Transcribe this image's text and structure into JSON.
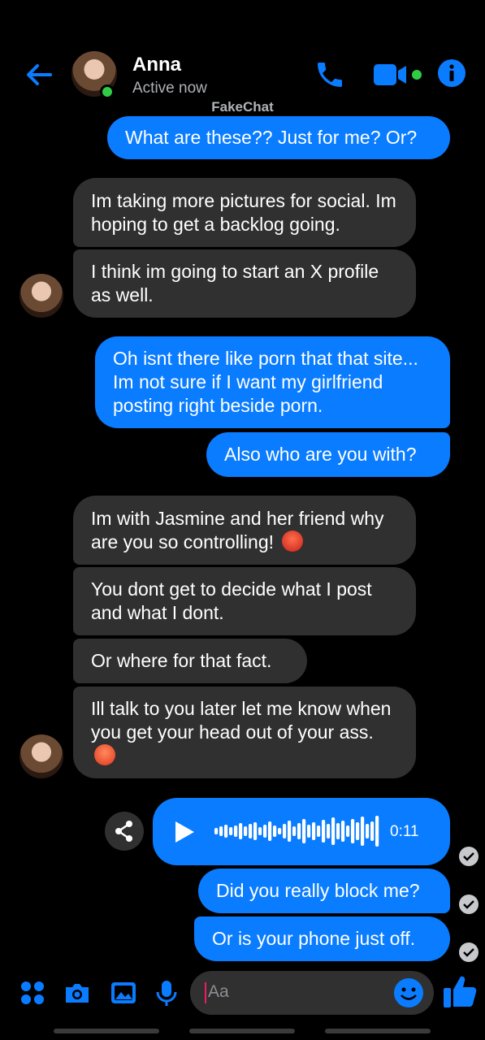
{
  "header": {
    "name": "Anna",
    "status": "Active now",
    "watermark": "FakeChat"
  },
  "messages": [
    {
      "text": "What are these?? Just for me? Or?"
    },
    {
      "text": "Im taking more pictures for social. Im hoping to get a backlog going."
    },
    {
      "text": "I think im going to start an X profile as well."
    },
    {
      "text": "Oh isnt there like porn that that site... Im not sure if I want my girlfriend posting right beside porn."
    },
    {
      "text": "Also who are you with?"
    },
    {
      "text": "Im with Jasmine and her friend why are you so controlling!"
    },
    {
      "text": "You dont get to decide what I post and what I dont."
    },
    {
      "text": "Or where for that fact."
    },
    {
      "text": "Ill talk to you later let me know when you get your head out of your ass."
    },
    {
      "text": "Did you really block me?"
    },
    {
      "text": "Or is your phone just off."
    }
  ],
  "voice": {
    "duration": "0:11"
  },
  "composer": {
    "placeholder": "Aa"
  },
  "colors": {
    "accent": "#0a7cff",
    "incoming": "#303030",
    "online": "#31cc46"
  }
}
